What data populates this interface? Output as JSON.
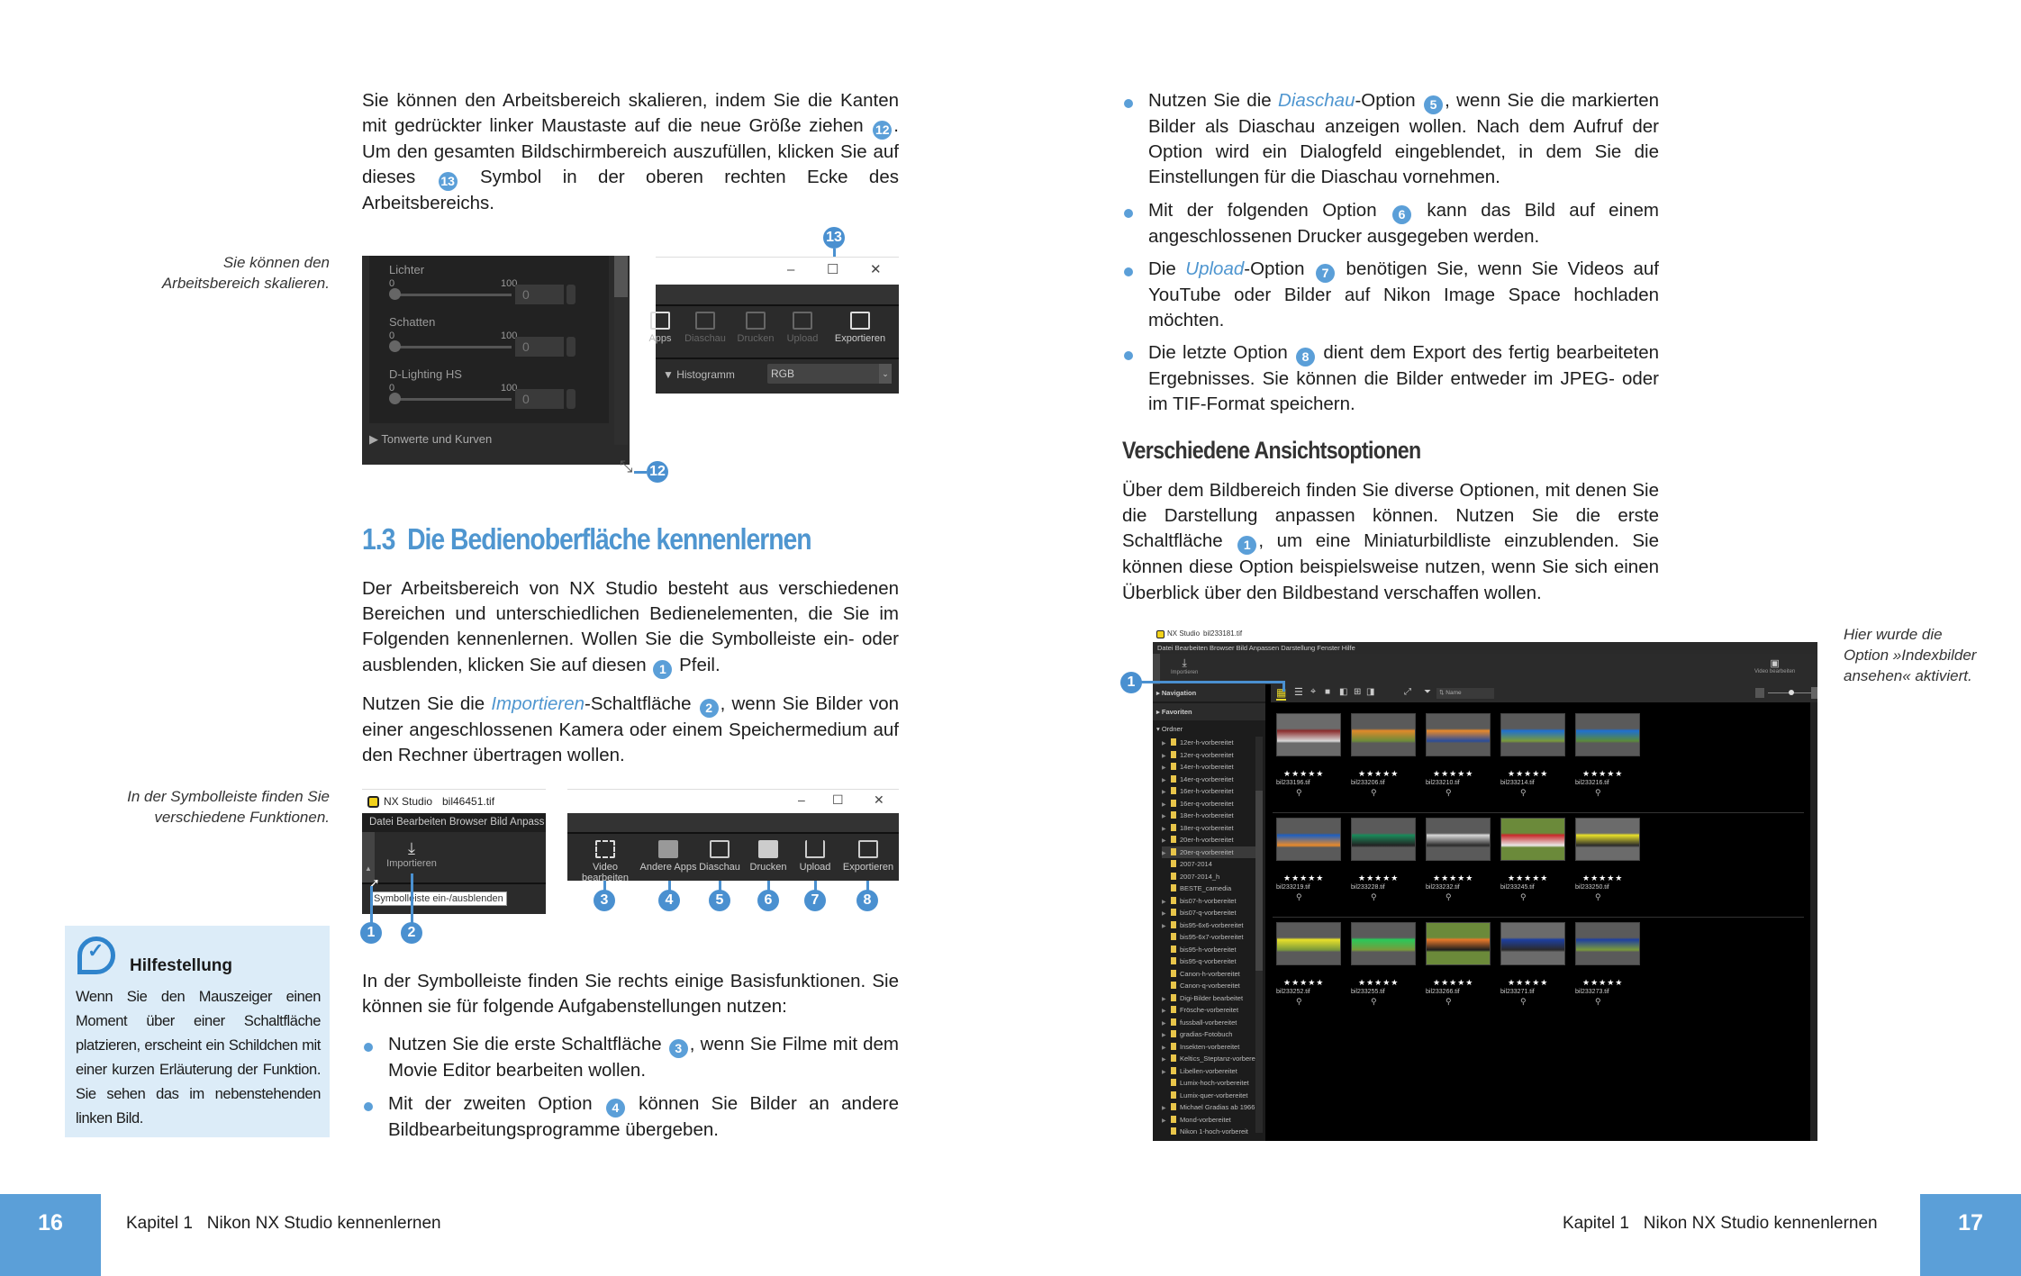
{
  "left_page": {
    "intro_paragraph": {
      "part1": "Sie können den Arbeitsbereich skalieren, indem Sie die Kanten mit gedrückter linker Maustaste auf die neue Größe ziehen ",
      "num_a": "12",
      "part2": ". Um den gesamten Bildschirmbereich auszufüllen, klicken Sie auf dieses ",
      "num_b": "13",
      "part3": " Symbol in der oberen rechten Ecke des Arbeitsbereichs."
    },
    "caption_1": "Sie können den Arbeitsbereich skalieren.",
    "figure_1": {
      "panel_left": {
        "sliders": [
          {
            "label": "Lichter",
            "min": "0",
            "max": "100",
            "value": "0"
          },
          {
            "label": "Schatten",
            "min": "0",
            "max": "100",
            "value": "0"
          },
          {
            "label": "D-Lighting HS",
            "min": "0",
            "max": "100",
            "value": "0"
          }
        ],
        "section": "Tonwerte und Kurven",
        "callout": "12"
      },
      "panel_right": {
        "callout": "13",
        "window_buttons": {
          "minimize": "–",
          "maximize": "☐",
          "close": "✕"
        },
        "toolbar": [
          "Apps",
          "Diaschau",
          "Drucken",
          "Upload",
          "Exportieren"
        ],
        "histogram_label": "Histogramm",
        "histogram_select": "RGB"
      }
    },
    "section_heading": {
      "number": "1.3",
      "title": "Die Bedienoberfläche kennenlernen"
    },
    "para_2": {
      "part1": "Der Arbeitsbereich von NX Studio besteht aus verschiedenen Bereichen und unterschiedlichen Bedienelementen, die Sie im Folgenden kennenlernen. Wollen Sie die Symbolleiste ein- oder ausblenden, klicken Sie auf diesen ",
      "num": "1",
      "part2": " Pfeil."
    },
    "para_3": {
      "part1": "Nutzen Sie die ",
      "emph": "Importieren",
      "part2": "-Schaltfläche ",
      "num": "2",
      "part3": ", wenn Sie Bilder von einer angeschlossenen Kamera oder einem Speichermedium auf den Rechner übertragen wollen."
    },
    "caption_2": "In der Symbolleiste finden Sie verschiedene Funktionen.",
    "figure_2": {
      "app_name": "NX Studio",
      "file_name": "bil46451.tif",
      "menu": [
        "Datei",
        "Bearbeiten",
        "Browser",
        "Bild",
        "Anpass"
      ],
      "import_label": "Importieren",
      "tooltip": "Symbolleiste ein-/ausblenden",
      "callouts_left": [
        "1",
        "2"
      ],
      "window_buttons": {
        "minimize": "–",
        "maximize": "☐",
        "close": "✕"
      },
      "toolbar": [
        {
          "label": "Video bearbeiten",
          "icon": "video-edit-icon",
          "callout": "3"
        },
        {
          "label": "Andere Apps",
          "icon": "other-apps-icon",
          "callout": "4"
        },
        {
          "label": "Diaschau",
          "icon": "slideshow-icon",
          "callout": "5"
        },
        {
          "label": "Drucken",
          "icon": "print-icon",
          "callout": "6"
        },
        {
          "label": "Upload",
          "icon": "upload-icon",
          "callout": "7"
        },
        {
          "label": "Exportieren",
          "icon": "export-icon",
          "callout": "8"
        }
      ]
    },
    "tip_box": {
      "title": "Hilfestellung",
      "text": "Wenn Sie den Mauszeiger einen Moment über einer Schaltfläche platzieren, erscheint ein Schildchen mit einer kurzen Erläuterung der Funktion. Sie sehen das im nebenstehenden linken Bild."
    },
    "para_4": "In der Symbolleiste finden Sie rechts einige Basisfunktionen. Sie können sie für folgende Aufgabenstellungen nutzen:",
    "bullets": [
      {
        "part1": "Nutzen Sie die erste Schaltfläche ",
        "num": "3",
        "part2": ", wenn Sie Filme mit dem Movie Editor bearbeiten wollen."
      },
      {
        "part1": "Mit der zweiten Option ",
        "num": "4",
        "part2": " können Sie Bilder an andere Bildbearbeitungsprogramme übergeben."
      }
    ],
    "footer": {
      "page_number": "16",
      "chapter": "Kapitel 1   Nikon NX Studio kennenlernen"
    }
  },
  "right_page": {
    "bullets": [
      {
        "part1": "Nutzen Sie die ",
        "emph": "Diaschau",
        "part2": "-Option ",
        "num": "5",
        "part3": ", wenn Sie die markierten Bilder als Diaschau anzeigen wollen. Nach dem Aufruf der Option wird ein Dialogfeld eingeblendet, in dem Sie die Einstellungen für die Diaschau vornehmen."
      },
      {
        "part1": "Mit der folgenden Option ",
        "emph": "",
        "part2": "",
        "num": "6",
        "part3": " kann das Bild auf einem angeschlossenen Drucker ausgegeben werden."
      },
      {
        "part1": "Die ",
        "emph": "Upload",
        "part2": "-Option ",
        "num": "7",
        "part3": " benötigen Sie, wenn Sie Videos auf YouTube oder Bilder auf Nikon Image Space hochladen möchten."
      },
      {
        "part1": "Die letzte Option ",
        "emph": "",
        "part2": "",
        "num": "8",
        "part3": " dient dem Export des fertig bearbeiteten Ergebnisses. Sie können die Bilder entweder im JPEG- oder im TIF-Format speichern."
      }
    ],
    "subheading": "Verschiedene Ansichtsoptionen",
    "para": {
      "part1": "Über dem Bildbereich finden Sie diverse Optionen, mit denen Sie die Darstellung anpassen können. Nutzen Sie die erste Schaltfläche ",
      "num": "1",
      "part2": ", um eine Miniaturbildliste einzublenden. Sie können diese Option beispielsweise nutzen, wenn Sie sich einen Überblick über den Bildbestand verschaffen wollen."
    },
    "caption": "Hier wurde die Option »Indexbilder ansehen« aktiviert.",
    "screenshot": {
      "app_name": "NX Studio",
      "file_name": "bil233181.tif",
      "menu": [
        "Datei",
        "Bearbeiten",
        "Browser",
        "Bild",
        "Anpassen",
        "Darstellung",
        "Fenster",
        "Hilfe"
      ],
      "import_label": "Importieren",
      "video_label": "Video bearbeiten",
      "callout": "1",
      "panels": [
        "Navigation",
        "Favoriten",
        "Ordner"
      ],
      "sort_label": "Name",
      "folders": [
        "12er-h-vorbereitet",
        "12er-q-vorbereitet",
        "14er-h-vorbereitet",
        "14er-q-vorbereitet",
        "16er-h-vorbereitet",
        "16er-q-vorbereitet",
        "18er-h-vorbereitet",
        "18er-q-vorbereitet",
        "20er-h-vorbereitet",
        "20er-q-vorbereitet",
        "2007-2014",
        "2007-2014_h",
        "BESTE_camedia",
        "bis07-h-vorbereitet",
        "bis07-q-vorbereitet",
        "bis95-6x6-vorbereitet",
        "bis95-6x7-vorbereitet",
        "bis95-h-vorbereitet",
        "bis95-q-vorbereitet",
        "Canon-h-vorbereitet",
        "Canon-q-vorbereitet",
        "Digi-Bilder bearbeitet",
        "Frösche-vorbereitet",
        "fussball-vorbereitet",
        "gradias-Fotobuch",
        "Insekten-vorbereitet",
        "Keltics_Steptanz-vorbere",
        "Libellen-vorbereitet",
        "Lumix-hoch-vorbereitet",
        "Lumix-quer-vorbereitet",
        "Michael Gradias ab 1966",
        "Mond-vorbereitet",
        "Nikon 1-hoch-vorbereit"
      ],
      "selected_folder": "20er-q-vorbereitet",
      "rating": "★★★★★",
      "thumbnails": [
        {
          "file": "bil233196.tif",
          "colors": [
            "#8a2b2b",
            "#d8d8d8",
            "#6b6b6b"
          ]
        },
        {
          "file": "bil233206.tif",
          "colors": [
            "#e08a2a",
            "#6c8b3a",
            "#5a5a5a"
          ]
        },
        {
          "file": "bil233210.tif",
          "colors": [
            "#e88a2a",
            "#2a4c9a",
            "#5a5a5a"
          ]
        },
        {
          "file": "bil233214.tif",
          "colors": [
            "#1e6fd0",
            "#7a9a3a",
            "#5a5a5a"
          ]
        },
        {
          "file": "bil233216.tif",
          "colors": [
            "#1e6fd0",
            "#5b8a3a",
            "#5a5a5a"
          ]
        },
        {
          "file": "bil233219.tif",
          "colors": [
            "#1e5fc0",
            "#e88a2a",
            "#5a5a5a"
          ]
        },
        {
          "file": "bil233228.tif",
          "colors": [
            "#1a8a5a",
            "#222222",
            "#5a5a5a"
          ]
        },
        {
          "file": "bil233232.tif",
          "colors": [
            "#d8d8d8",
            "#2a2a2a",
            "#5a5a5a"
          ]
        },
        {
          "file": "bil233245.tif",
          "colors": [
            "#c82a2a",
            "#e8e8e8",
            "#6b8a3a"
          ]
        },
        {
          "file": "bil233250.tif",
          "colors": [
            "#e8e02a",
            "#2a2a2a",
            "#6b6b6b"
          ]
        },
        {
          "file": "bil233252.tif",
          "colors": [
            "#e8e02a",
            "#7a9a3a",
            "#5a5a5a"
          ]
        },
        {
          "file": "bil233255.tif",
          "colors": [
            "#2ac85a",
            "#7a9a3a",
            "#5a5a5a"
          ]
        },
        {
          "file": "bil233266.tif",
          "colors": [
            "#e8782a",
            "#1e1e1e",
            "#6b8a3a"
          ]
        },
        {
          "file": "bil233271.tif",
          "colors": [
            "#1e3fa0",
            "#2a2a2a",
            "#6b6b6b"
          ]
        },
        {
          "file": "bil233273.tif",
          "colors": [
            "#1e3fa0",
            "#7a9a3a",
            "#5a5a5a"
          ]
        }
      ]
    },
    "footer": {
      "page_number": "17",
      "chapter": "Kapitel 1   Nikon NX Studio kennenlernen"
    }
  },
  "colors": {
    "accent": "#5b9fd8",
    "heading": "#4f96d0",
    "tip_bg": "#dcecf8"
  }
}
